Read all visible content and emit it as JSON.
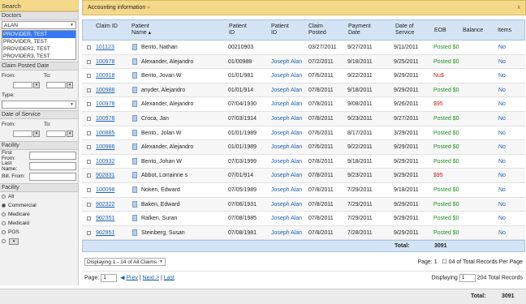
{
  "sidebar": {
    "search_label": "Search",
    "doctors_label": "Doctors",
    "doctor_selected": "ALAN",
    "provider_list": [
      "PROVIDER, TEST",
      "PROVIDER, TEST",
      "PROVIDER2, TEST",
      "PROVIDER3, TEST"
    ],
    "claim_posted_label": "Claim Posted Date",
    "from_label": "From:",
    "to_label": "To:",
    "type_label": "Type:",
    "date_of_service_label": "Date of Service",
    "facility_label": "Facility",
    "first_from_label": "First From:",
    "last_name_label": "Last Name:",
    "bill_from_label": "Bill. From:",
    "facility2_label": "Facility",
    "facility_options": [
      "All",
      "Commercial",
      "Medicare",
      "Medicaid",
      "POS"
    ]
  },
  "main": {
    "accounting_title": "Accounting information",
    "chevron": "»",
    "close": "x",
    "columns": [
      "Claim ID",
      "Patient Name",
      "Patient ID",
      "Patient ID",
      "Claim Posted",
      "Payment Date",
      "Date of Service",
      "EOB",
      "Balance",
      "Items"
    ],
    "rows": [
      {
        "claim": "101123",
        "name": "Bento, Nathan",
        "pid": "00210903",
        "pid2": "",
        "posted": "03/27/2011",
        "pay": "9/27/2011",
        "dos": "9/11/2011",
        "eob": "Posted $0",
        "eob_type": "green",
        "items": "No"
      },
      {
        "claim": "100978",
        "name": "Alexander, Alejandro",
        "pid": "01/00988",
        "pid2": "Joseph Alan",
        "posted": "07/2/2011",
        "pay": "9/18/2011",
        "dos": "9/25/2011",
        "eob": "Posted $0",
        "eob_type": "green",
        "items": "No"
      },
      {
        "claim": "100918",
        "name": "Bento, Jovan W",
        "pid": "01/01/981",
        "pid2": "Joseph Alan",
        "posted": "07/6/2011",
        "pay": "9/22/2011",
        "dos": "9/29/2011",
        "eob": "Nu$",
        "eob_type": "red",
        "items": "No"
      },
      {
        "claim": "100988",
        "name": "anyder, Alejandro",
        "pid": "01/01/914",
        "pid2": "Joseph Alan",
        "posted": "07/8/2011",
        "pay": "9/18/2011",
        "dos": "9/29/2011",
        "eob": "Posted $0",
        "eob_type": "green",
        "items": "No"
      },
      {
        "claim": "100978",
        "name": "Alexander, Alejandro",
        "pid": "07/04/1930",
        "pid2": "Joseph Alan",
        "posted": "07/8/2011",
        "pay": "9/08/2011",
        "dos": "9/26/2011",
        "eob": "$95",
        "eob_type": "red",
        "items": "No"
      },
      {
        "claim": "100976",
        "name": "Croca, Jan",
        "pid": "07/03/1914",
        "pid2": "Joseph Alan",
        "posted": "07/8/2011",
        "pay": "9/23/2011",
        "dos": "9/27/2011",
        "eob": "Posted $0",
        "eob_type": "green",
        "items": "No"
      },
      {
        "claim": "100885",
        "name": "Bento,. Jolan W",
        "pid": "01/01/1989",
        "pid2": "Joseph Alan",
        "posted": "07/6/2011",
        "pay": "8/17/2011",
        "dos": "3/29/2011",
        "eob": "Posted $0",
        "eob_type": "green",
        "items": "No"
      },
      {
        "claim": "100986",
        "name": "Alexander, Alejandro",
        "pid": "01/01/1989",
        "pid2": "Joseph Alan",
        "posted": "07/6/2011",
        "pay": "9/22/2011",
        "dos": "9/29/2011",
        "eob": "Posted $0",
        "eob_type": "green",
        "items": "No"
      },
      {
        "claim": "100932",
        "name": "Bento, Johan W",
        "pid": "07/03/1999",
        "pid2": "Joseph Alan",
        "posted": "07/8/2011",
        "pay": "9/18/2011",
        "dos": "9/29/2011",
        "eob": "Posted $0",
        "eob_type": "green",
        "items": "No"
      },
      {
        "claim": "902831",
        "name": "Abbot, Lorrainne s",
        "pid": "07/01/914",
        "pid2": "Joseph Alan",
        "posted": "07/8/2011",
        "pay": "9/23/2011",
        "dos": "9/29/2011",
        "eob": "$95",
        "eob_type": "red",
        "items": "No"
      },
      {
        "claim": "100098",
        "name": "Noken, Edward",
        "pid": "07/05/1989",
        "pid2": "Joseph Alan",
        "posted": "07/8/2011",
        "pay": "7/29/2011",
        "dos": "9/18/2011",
        "eob": "Posted $0",
        "eob_type": "green",
        "items": "No"
      },
      {
        "claim": "902322",
        "name": "Baken, Edward",
        "pid": "07/06/1931",
        "pid2": "Joseph Alan",
        "posted": "07/8/2011",
        "pay": "7/29/2011",
        "dos": "9/29/2011",
        "eob": "Posted $0",
        "eob_type": "green",
        "items": "No"
      },
      {
        "claim": "902351",
        "name": "Ralken, Suran",
        "pid": "07/08/1985",
        "pid2": "Joseph Alan",
        "posted": "07/8/2011",
        "pay": "7/29/2011",
        "dos": "9/29/2011",
        "eob": "Posted $0",
        "eob_type": "green",
        "items": "No"
      },
      {
        "claim": "902951",
        "name": "Steinberg, Susan",
        "pid": "07/08/1981",
        "pid2": "Joseph Alan",
        "posted": "07/8/2011",
        "pay": "7/28/2011",
        "dos": "9/29/2011",
        "eob": "Posted $0",
        "eob_type": "green",
        "items": "No"
      }
    ],
    "total_label": "Total:",
    "total_value": "3091",
    "displaying_text": "Displaying 1 - 14 of All Claims",
    "page_label": "Page: 1",
    "records_per_page": "04 of Total Records Per Page",
    "page_prefix": "Page:",
    "page_value": "1",
    "prev": "Prev",
    "next": "Next >",
    "last": "Last",
    "displaying_prefix": "Displaying",
    "displaying_start": "1",
    "displaying_total": "204 Total Records"
  },
  "footer": {
    "total_label": "Total:",
    "total_value": "3091"
  },
  "colors": {
    "accent": "#f5d98a",
    "header": "#d4e4f5",
    "link": "#1a5fb4",
    "posted": "#1f8f1f",
    "due": "#d01818"
  }
}
